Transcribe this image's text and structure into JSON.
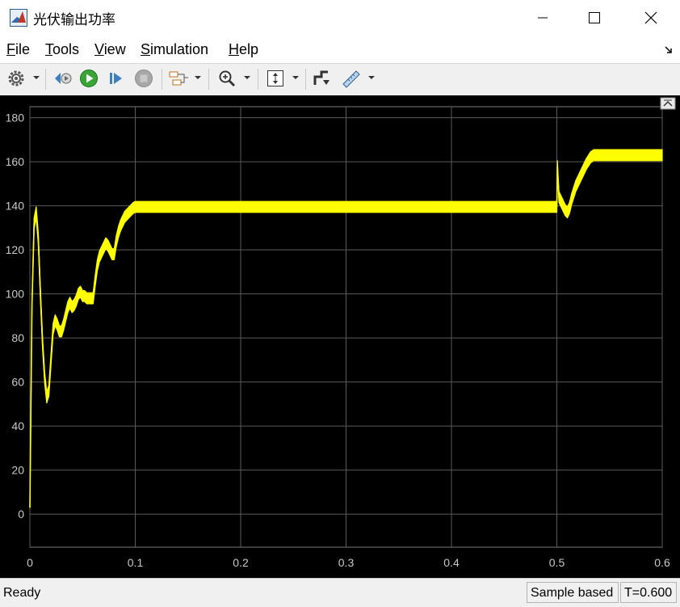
{
  "window": {
    "title": "光伏输出功率",
    "icon": "matlab-icon",
    "controls": [
      "minimize-icon",
      "maximize-icon",
      "close-icon"
    ]
  },
  "menu": {
    "items": [
      {
        "label": "File",
        "name": "menu-file"
      },
      {
        "label": "Tools",
        "name": "menu-tools"
      },
      {
        "label": "View",
        "name": "menu-view"
      },
      {
        "label": "Simulation",
        "name": "menu-simulation"
      },
      {
        "label": "Help",
        "name": "menu-help"
      }
    ]
  },
  "toolbar": {
    "buttons": [
      "settings-icon",
      "step-back-icon",
      "run-icon",
      "step-forward-icon",
      "stop-icon",
      "signal-selector-icon",
      "zoom-icon",
      "autoscale-icon",
      "highlight-block-icon",
      "measurement-icon"
    ]
  },
  "status": {
    "text": "Ready",
    "mode": "Sample based",
    "time": "T=0.600"
  },
  "colors": {
    "trace": "#ffff00",
    "plot_bg": "#000000",
    "grid": "#5a5a5a",
    "tick_label": "#c8c8c8"
  },
  "chart_data": {
    "type": "line",
    "title": "",
    "xlabel": "",
    "ylabel": "",
    "xlim": [
      0,
      0.6
    ],
    "ylim": [
      -15,
      185
    ],
    "xticks": [
      0,
      0.1,
      0.2,
      0.3,
      0.4,
      0.5,
      0.6
    ],
    "yticks": [
      0,
      20,
      40,
      60,
      80,
      100,
      120,
      140,
      160,
      180
    ],
    "grid": true,
    "series": [
      {
        "name": "",
        "band": 2.5,
        "x": [
          0.0,
          0.002,
          0.004,
          0.006,
          0.008,
          0.01,
          0.012,
          0.014,
          0.016,
          0.018,
          0.02,
          0.022,
          0.024,
          0.026,
          0.028,
          0.03,
          0.032,
          0.034,
          0.036,
          0.038,
          0.04,
          0.042,
          0.044,
          0.046,
          0.048,
          0.05,
          0.052,
          0.054,
          0.056,
          0.058,
          0.06,
          0.062,
          0.064,
          0.066,
          0.068,
          0.07,
          0.072,
          0.074,
          0.076,
          0.078,
          0.08,
          0.082,
          0.084,
          0.086,
          0.088,
          0.09,
          0.092,
          0.094,
          0.096,
          0.098,
          0.1,
          0.102,
          0.104,
          0.106,
          0.108,
          0.11,
          0.112,
          0.114,
          0.116,
          0.118,
          0.12,
          0.122,
          0.124,
          0.126,
          0.128,
          0.13,
          0.132,
          0.134,
          0.136,
          0.138,
          0.14,
          0.15,
          0.2,
          0.3,
          0.4,
          0.45,
          0.49,
          0.4999,
          0.5,
          0.5005,
          0.502,
          0.506,
          0.508,
          0.51,
          0.512,
          0.514,
          0.516,
          0.518,
          0.52,
          0.524,
          0.528,
          0.532,
          0.535,
          0.54,
          0.55,
          0.6
        ],
        "y": [
          3,
          95,
          132,
          137,
          125,
          100,
          78,
          62,
          53,
          56,
          70,
          84,
          88,
          86,
          83,
          83,
          86,
          90,
          94,
          96,
          94,
          95,
          97,
          100,
          101,
          99,
          99,
          98,
          98,
          98,
          98,
          106,
          113,
          117,
          119,
          121,
          123,
          122,
          120,
          118,
          118,
          124,
          128,
          131,
          133,
          135,
          136,
          137,
          138,
          139,
          139.5,
          139.5,
          139.5,
          139.5,
          139.5,
          139.5,
          139.5,
          139.5,
          139.5,
          139.5,
          139.5,
          139.5,
          139.5,
          139.5,
          139.5,
          139.5,
          139.5,
          139.5,
          139.5,
          139.5,
          139.5,
          139.5,
          139.5,
          139.5,
          139.5,
          139.5,
          139.5,
          139.5,
          139.5,
          158,
          144,
          140,
          138,
          137,
          139,
          143,
          146,
          149,
          151,
          155,
          159,
          162,
          163,
          163,
          163,
          163
        ]
      }
    ]
  }
}
